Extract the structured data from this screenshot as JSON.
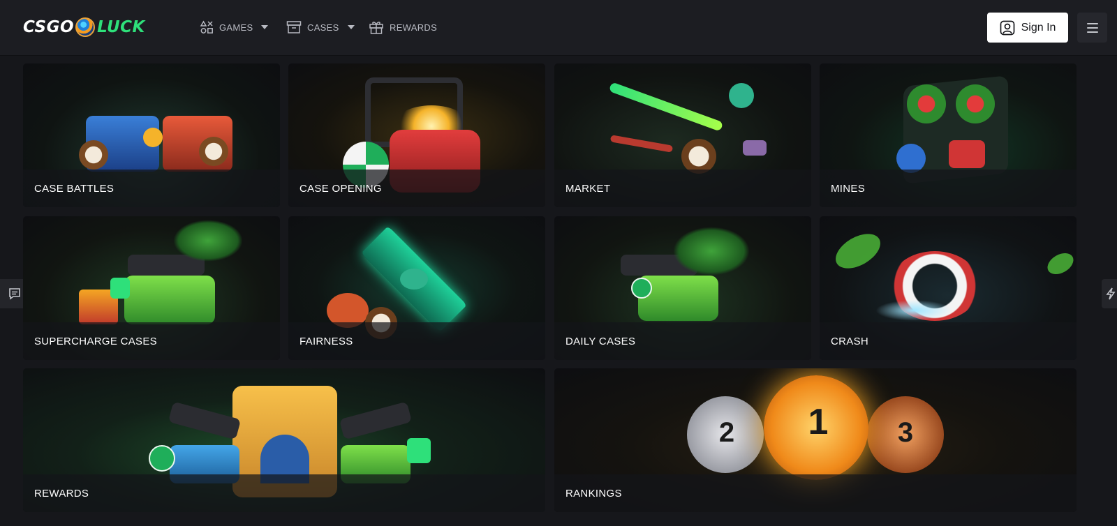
{
  "header": {
    "logo": {
      "left_text": "CSGO",
      "right_text": "LUCK"
    },
    "nav": [
      {
        "label": "GAMES",
        "icon": "games-icon",
        "has_dropdown": true
      },
      {
        "label": "CASES",
        "icon": "case-icon",
        "has_dropdown": true
      },
      {
        "label": "REWARDS",
        "icon": "gift-icon",
        "has_dropdown": false
      }
    ],
    "sign_in_label": "Sign In"
  },
  "sidebar": {
    "chat_icon": "chat-icon",
    "right_icon": "lightning-icon"
  },
  "cards": [
    {
      "title": "CASE BATTLES",
      "icon": "case-battles-art"
    },
    {
      "title": "CASE OPENING",
      "icon": "case-opening-art"
    },
    {
      "title": "MARKET",
      "icon": "market-art"
    },
    {
      "title": "MINES",
      "icon": "mines-art"
    },
    {
      "title": "SUPERCHARGE CASES",
      "icon": "supercharge-art"
    },
    {
      "title": "FAIRNESS",
      "icon": "fairness-art"
    },
    {
      "title": "DAILY CASES",
      "icon": "daily-cases-art"
    },
    {
      "title": "CRASH",
      "icon": "crash-art"
    },
    {
      "title": "REWARDS",
      "icon": "rewards-art"
    },
    {
      "title": "RANKINGS",
      "icon": "rankings-art"
    }
  ],
  "colors": {
    "accent": "#2ee07a",
    "background": "#16171b",
    "header": "#1c1d22"
  }
}
